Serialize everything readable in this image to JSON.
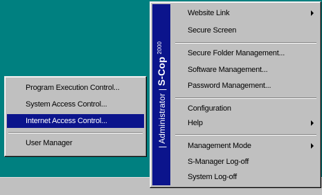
{
  "banner": {
    "role": "Administrator",
    "brand": "S-Cop",
    "year": "2000"
  },
  "main_menu": {
    "items": [
      {
        "label": "Website Link",
        "submenu": true
      },
      {
        "label": "Secure Screen",
        "submenu": false
      },
      {
        "label": "Secure Folder Management...",
        "submenu": false
      },
      {
        "label": "Software Management...",
        "submenu": false
      },
      {
        "label": "Password Management...",
        "submenu": false
      },
      {
        "label": "Configuration",
        "submenu": false
      },
      {
        "label": "Help",
        "submenu": true
      },
      {
        "label": "Management Mode",
        "submenu": true
      },
      {
        "label": "S-Manager Log-off",
        "submenu": false
      },
      {
        "label": "System Log-off",
        "submenu": false
      }
    ]
  },
  "sub_menu": {
    "items": [
      {
        "label": "Program Execution Control...",
        "selected": false
      },
      {
        "label": "System Access Control...",
        "selected": false
      },
      {
        "label": "Internet Access Control...",
        "selected": true
      },
      {
        "label": "User Manager",
        "selected": false
      }
    ]
  },
  "colors": {
    "desktop": "#008080",
    "menu_face": "#c0c0c0",
    "highlight": "#0b148c"
  },
  "icons": {
    "submenu_arrow": "triangle-right",
    "tray": "scop-tray-icon"
  }
}
